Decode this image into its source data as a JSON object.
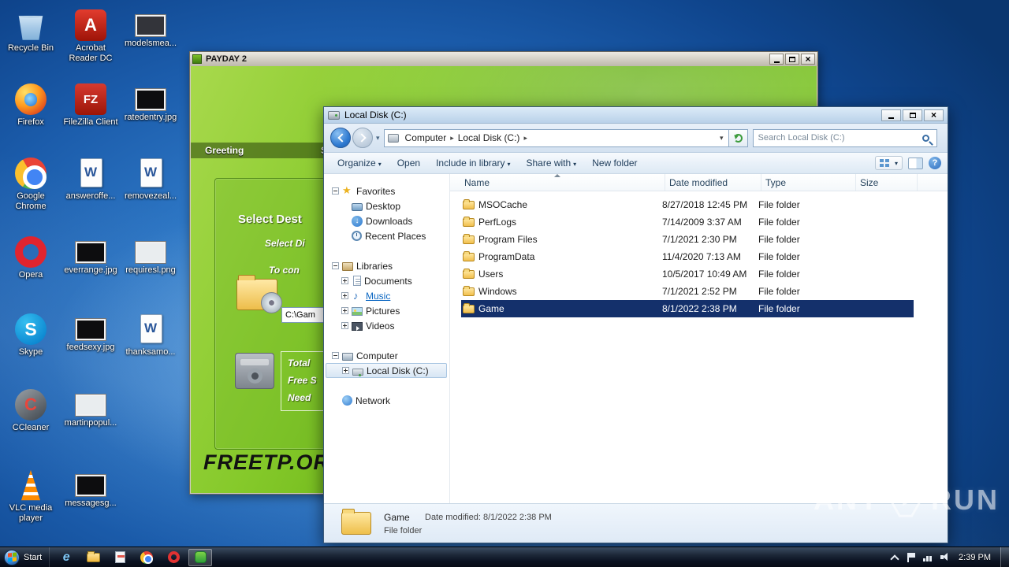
{
  "desktop": {
    "icons": [
      {
        "label": "Recycle Bin",
        "kind": "recycle"
      },
      {
        "label": "Acrobat Reader DC",
        "kind": "acrobat"
      },
      {
        "label": "modelsmea...",
        "kind": "thumb-dark"
      },
      {
        "label": "Firefox",
        "kind": "firefox"
      },
      {
        "label": "FileZilla Client",
        "kind": "filezilla"
      },
      {
        "label": "ratedentry.jpg",
        "kind": "thumb-black"
      },
      {
        "label": "Google Chrome",
        "kind": "chrome"
      },
      {
        "label": "answeroffe...",
        "kind": "word"
      },
      {
        "label": "removezeal...",
        "kind": "word"
      },
      {
        "label": "Opera",
        "kind": "opera"
      },
      {
        "label": "everrange.jpg",
        "kind": "thumb-black"
      },
      {
        "label": "requiresl.png",
        "kind": "thumb-light"
      },
      {
        "label": "Skype",
        "kind": "skype"
      },
      {
        "label": "feedsexy.jpg",
        "kind": "thumb-black"
      },
      {
        "label": "thanksamo...",
        "kind": "word"
      },
      {
        "label": "CCleaner",
        "kind": "ccleaner"
      },
      {
        "label": "martinpopul...",
        "kind": "thumb-light"
      },
      {
        "label": "VLC media player",
        "kind": "vlc"
      },
      {
        "label": "messagesg...",
        "kind": "thumb-black"
      }
    ]
  },
  "payday": {
    "title": "PAYDAY 2",
    "tabs": [
      "Greeting",
      "Sys"
    ],
    "heading": "Select Dest",
    "line1": "Select Di",
    "line2": "To con",
    "path_value": "C:\\Gam",
    "info_lines": [
      "Total",
      "Free S",
      "Need"
    ],
    "footer": "FREETP.OR"
  },
  "explorer": {
    "title": "Local Disk (C:)",
    "breadcrumb": [
      "Computer",
      "Local Disk (C:)"
    ],
    "search_placeholder": "Search Local Disk (C:)",
    "toolbar": [
      {
        "label": "Organize",
        "caret": true
      },
      {
        "label": "Open",
        "caret": false
      },
      {
        "label": "Include in library",
        "caret": true
      },
      {
        "label": "Share with",
        "caret": true
      },
      {
        "label": "New folder",
        "caret": false
      }
    ],
    "columns": [
      {
        "label": "Name",
        "sorted": true
      },
      {
        "label": "Date modified",
        "sorted": false
      },
      {
        "label": "Type",
        "sorted": false
      },
      {
        "label": "Size",
        "sorted": false
      }
    ],
    "rows": [
      {
        "name": "MSOCache",
        "date": "8/27/2018 12:45 PM",
        "type": "File folder",
        "size": "",
        "selected": false
      },
      {
        "name": "PerfLogs",
        "date": "7/14/2009 3:37 AM",
        "type": "File folder",
        "size": "",
        "selected": false
      },
      {
        "name": "Program Files",
        "date": "7/1/2021 2:30 PM",
        "type": "File folder",
        "size": "",
        "selected": false
      },
      {
        "name": "ProgramData",
        "date": "11/4/2020 7:13 AM",
        "type": "File folder",
        "size": "",
        "selected": false
      },
      {
        "name": "Users",
        "date": "10/5/2017 10:49 AM",
        "type": "File folder",
        "size": "",
        "selected": false
      },
      {
        "name": "Windows",
        "date": "7/1/2021 2:52 PM",
        "type": "File folder",
        "size": "",
        "selected": false
      },
      {
        "name": "Game",
        "date": "8/1/2022 2:38 PM",
        "type": "File folder",
        "size": "",
        "selected": true
      }
    ],
    "sidebar": [
      {
        "label": "Favorites",
        "depth": 0,
        "expander": "minus",
        "icon": "star",
        "gap": false,
        "state": null
      },
      {
        "label": "Desktop",
        "depth": 1,
        "expander": null,
        "icon": "desktop",
        "gap": false,
        "state": null
      },
      {
        "label": "Downloads",
        "depth": 1,
        "expander": null,
        "icon": "downloads",
        "gap": false,
        "state": null
      },
      {
        "label": "Recent Places",
        "depth": 1,
        "expander": null,
        "icon": "recent",
        "gap": false,
        "state": null
      },
      {
        "label": "Libraries",
        "depth": 0,
        "expander": "minus",
        "icon": "libraries",
        "gap": true,
        "state": null
      },
      {
        "label": "Documents",
        "depth": 1,
        "expander": "plus",
        "icon": "documents",
        "gap": false,
        "state": null
      },
      {
        "label": "Music",
        "depth": 1,
        "expander": "plus",
        "icon": "music",
        "gap": false,
        "state": "link"
      },
      {
        "label": "Pictures",
        "depth": 1,
        "expander": "plus",
        "icon": "pictures",
        "gap": false,
        "state": null
      },
      {
        "label": "Videos",
        "depth": 1,
        "expander": "plus",
        "icon": "videos",
        "gap": false,
        "state": null
      },
      {
        "label": "Computer",
        "depth": 0,
        "expander": "minus",
        "icon": "computer",
        "gap": true,
        "state": null
      },
      {
        "label": "Local Disk (C:)",
        "depth": 1,
        "expander": "plus",
        "icon": "disk",
        "gap": false,
        "state": "selected"
      },
      {
        "label": "Network",
        "depth": 0,
        "expander": null,
        "icon": "network",
        "gap": true,
        "state": null
      }
    ],
    "details": {
      "name": "Game",
      "date_label": "Date modified:",
      "date_value": "8/1/2022 2:38 PM",
      "type": "File folder"
    }
  },
  "taskbar": {
    "start_label": "Start",
    "apps": [
      {
        "kind": "ie",
        "name": "internet-explorer",
        "active": false
      },
      {
        "kind": "folder",
        "name": "windows-explorer",
        "active": false
      },
      {
        "kind": "doc",
        "name": "document-app",
        "active": false
      },
      {
        "kind": "chrome",
        "name": "google-chrome",
        "active": false
      },
      {
        "kind": "opera",
        "name": "opera",
        "active": false
      },
      {
        "kind": "green",
        "name": "installer-app",
        "active": true
      }
    ],
    "tray": [
      "chevron-up",
      "flag",
      "network",
      "volume"
    ],
    "clock": "2:39 PM"
  },
  "watermark": {
    "left": "ANY",
    "right": "RUN"
  }
}
